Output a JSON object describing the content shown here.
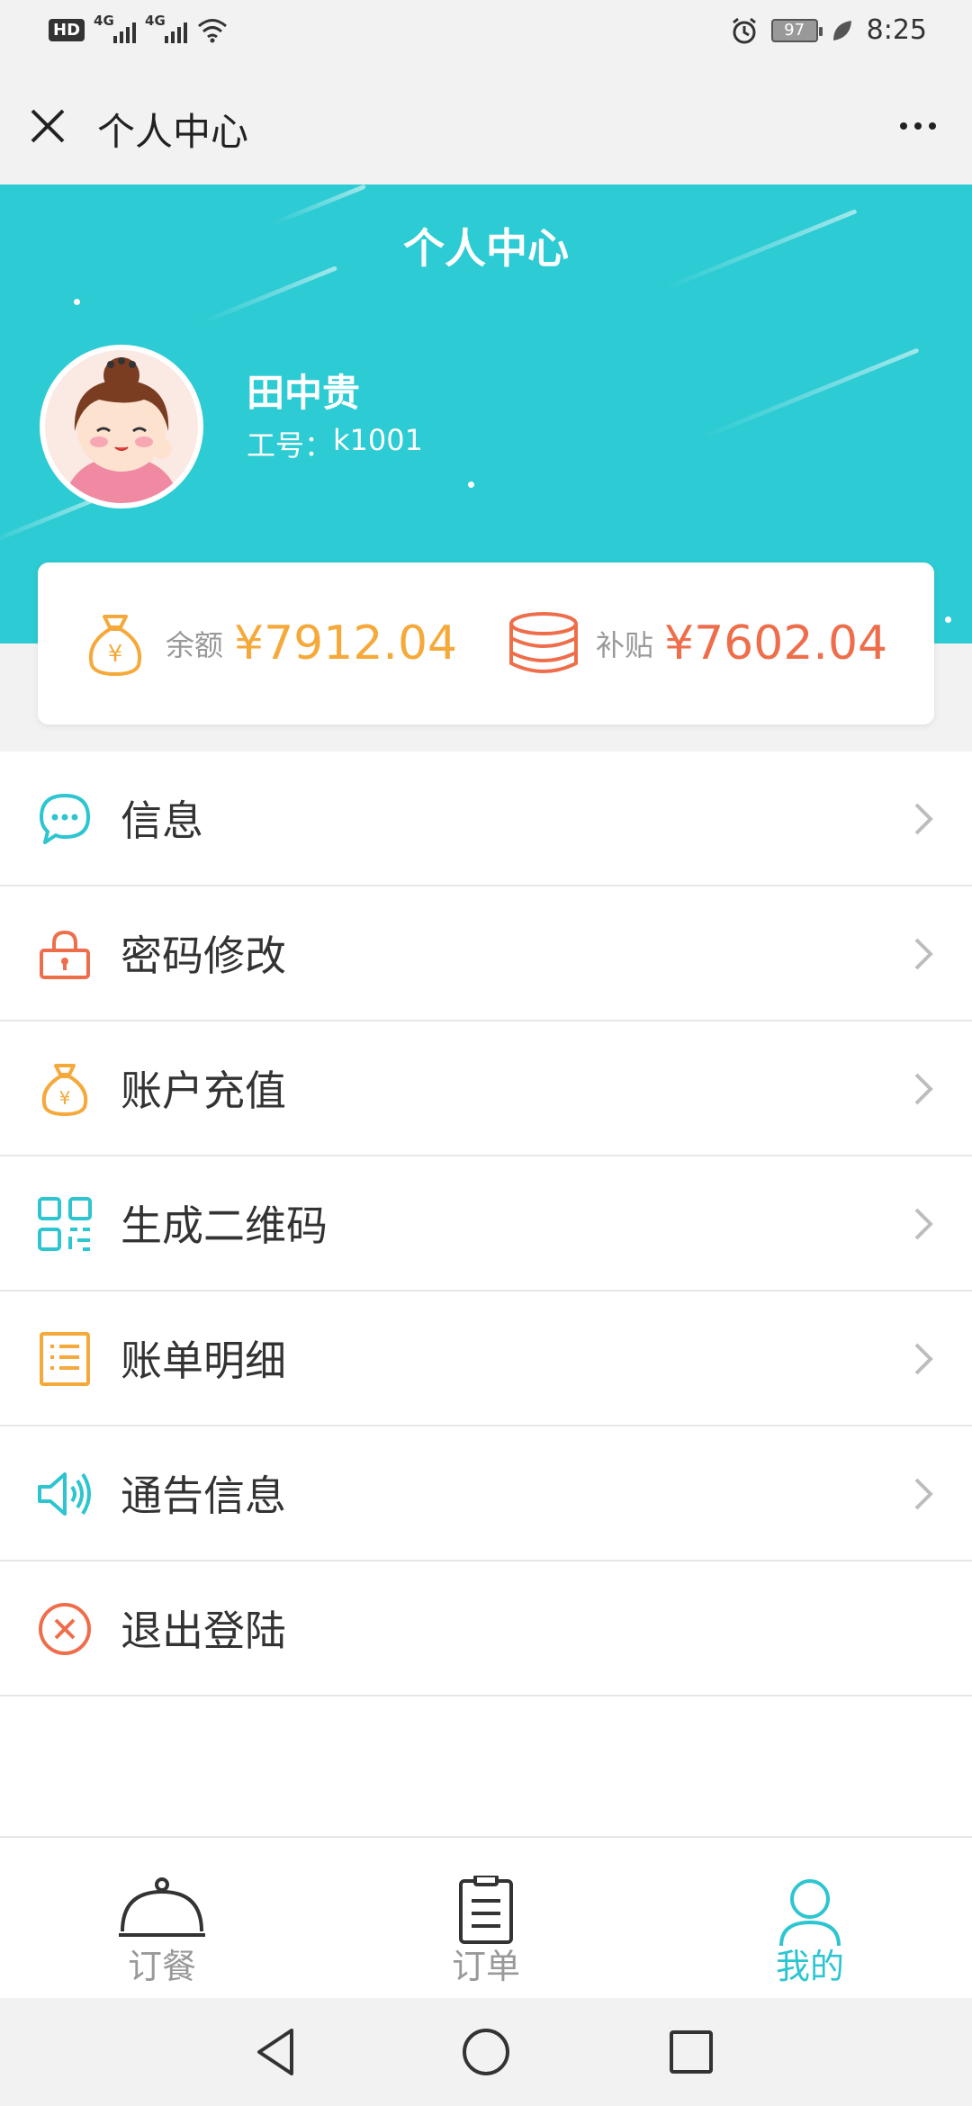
{
  "status_bar": {
    "hd": "HD",
    "net1": "4G",
    "net2": "4G",
    "battery": "97",
    "time": "8:25"
  },
  "app_bar": {
    "title": "个人中心"
  },
  "header": {
    "title": "个人中心",
    "user_name": "田中贵",
    "emp_label": "工号：",
    "emp_id": "k1001"
  },
  "balance": {
    "balance_label": "余额",
    "balance_value": "¥7912.04",
    "subsidy_label": "补贴",
    "subsidy_value": "¥7602.04"
  },
  "menu": [
    {
      "label": "信息",
      "icon": "chat-bubble-icon",
      "chevron": true
    },
    {
      "label": "密码修改",
      "icon": "lock-icon",
      "chevron": true
    },
    {
      "label": "账户充值",
      "icon": "money-bag-icon",
      "chevron": true
    },
    {
      "label": "生成二维码",
      "icon": "qr-code-icon",
      "chevron": true
    },
    {
      "label": "账单明细",
      "icon": "list-icon",
      "chevron": true
    },
    {
      "label": "通告信息",
      "icon": "speaker-icon",
      "chevron": true
    },
    {
      "label": "退出登陆",
      "icon": "close-circle-icon",
      "chevron": false
    }
  ],
  "tabs": [
    {
      "label": "订餐",
      "icon": "cloche-icon",
      "active": false
    },
    {
      "label": "订单",
      "icon": "clipboard-icon",
      "active": false
    },
    {
      "label": "我的",
      "icon": "user-icon",
      "active": true
    }
  ],
  "colors": {
    "accent": "#2dcbd3",
    "orange": "#f5a93a",
    "red": "#ee6e4b"
  }
}
